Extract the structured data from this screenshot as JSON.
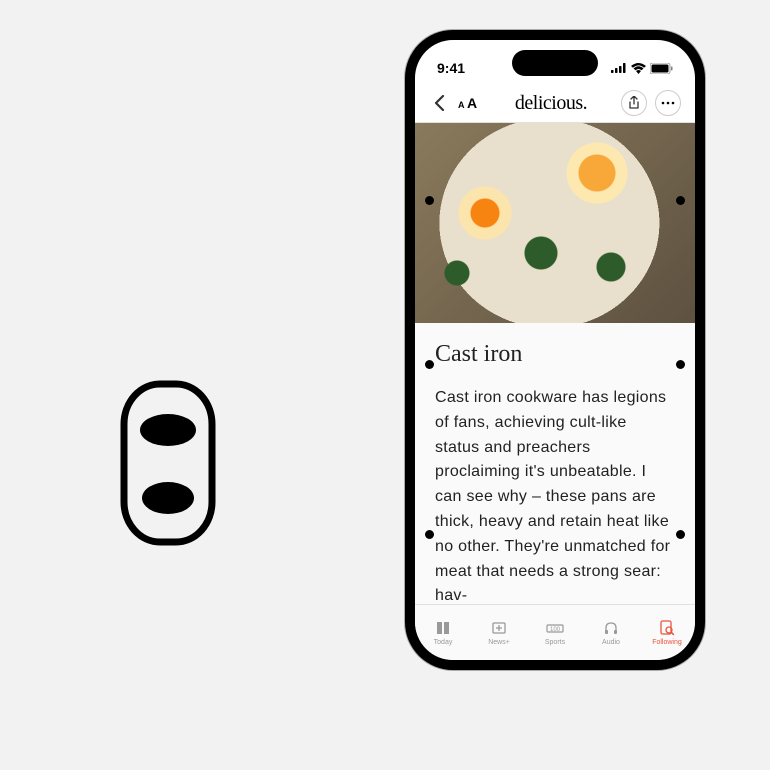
{
  "status": {
    "time": "9:41"
  },
  "nav": {
    "title": "delicious."
  },
  "article": {
    "title": "Cast iron",
    "body": "Cast iron cookware has legions of fans, achieving cult-like status and preachers proclaiming it's unbeatable. I can see why – these pans are thick, heavy and retain heat like no other. They're unmatched for meat that needs a strong sear: hav-"
  },
  "tabs": [
    {
      "label": "Today"
    },
    {
      "label": "News+"
    },
    {
      "label": "Sports"
    },
    {
      "label": "Audio"
    },
    {
      "label": "Following"
    }
  ],
  "active_tab": 4
}
